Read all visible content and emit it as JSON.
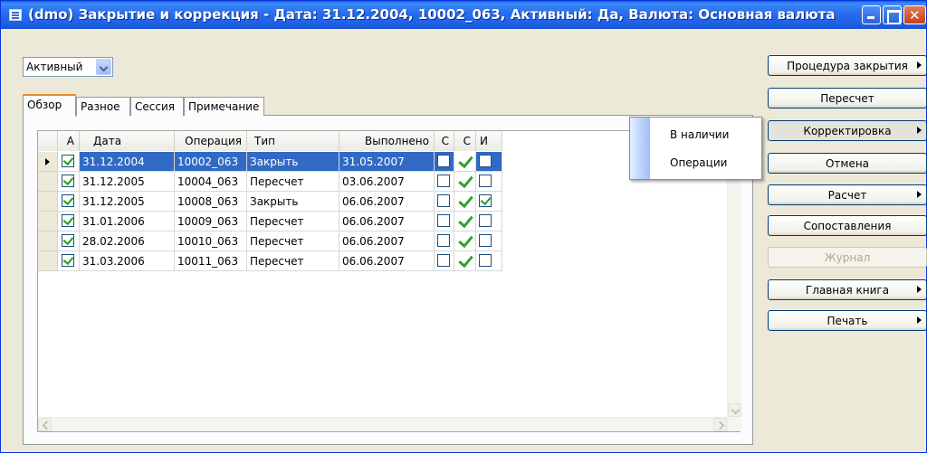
{
  "window": {
    "title": "(dmo) Закрытие и коррекция - Дата: 31.12.2004, 10002_063, Активный: Да, Валюта: Основная валюта"
  },
  "status_filter": {
    "value": "Активный"
  },
  "tabs": [
    {
      "label": "Обзор"
    },
    {
      "label": "Разное"
    },
    {
      "label": "Сессия"
    },
    {
      "label": "Примечание"
    }
  ],
  "grid": {
    "columns": [
      "А",
      "Дата",
      "Операция",
      "Тип",
      "Выполнено",
      "С",
      "С",
      "И"
    ],
    "rows": [
      {
        "active": true,
        "date": "31.12.2004",
        "operation": "10002_063",
        "type": "Закрыть",
        "done": "31.05.2007",
        "c1": false,
        "c2": true,
        "i": false
      },
      {
        "active": true,
        "date": "31.12.2005",
        "operation": "10004_063",
        "type": "Пересчет",
        "done": "03.06.2007",
        "c1": false,
        "c2": true,
        "i": false
      },
      {
        "active": true,
        "date": "31.12.2005",
        "operation": "10008_063",
        "type": "Закрыть",
        "done": "06.06.2007",
        "c1": false,
        "c2": true,
        "i": true
      },
      {
        "active": true,
        "date": "31.01.2006",
        "operation": "10009_063",
        "type": "Пересчет",
        "done": "06.06.2007",
        "c1": false,
        "c2": true,
        "i": false
      },
      {
        "active": true,
        "date": "28.02.2006",
        "operation": "10010_063",
        "type": "Пересчет",
        "done": "06.06.2007",
        "c1": false,
        "c2": true,
        "i": false
      },
      {
        "active": true,
        "date": "31.03.2006",
        "operation": "10011_063",
        "type": "Пересчет",
        "done": "06.06.2007",
        "c1": false,
        "c2": true,
        "i": false
      }
    ]
  },
  "buttons": {
    "close_procedure": "Процедура закрытия",
    "recalc": "Пересчет",
    "adjustment": "Корректировка",
    "cancel": "Отмена",
    "calculation": "Расчет",
    "matching": "Сопоставления",
    "journal": "Журнал",
    "general_ledger": "Главная книга",
    "print": "Печать"
  },
  "popup_menu": {
    "items": [
      "В наличии",
      "Операции"
    ]
  }
}
